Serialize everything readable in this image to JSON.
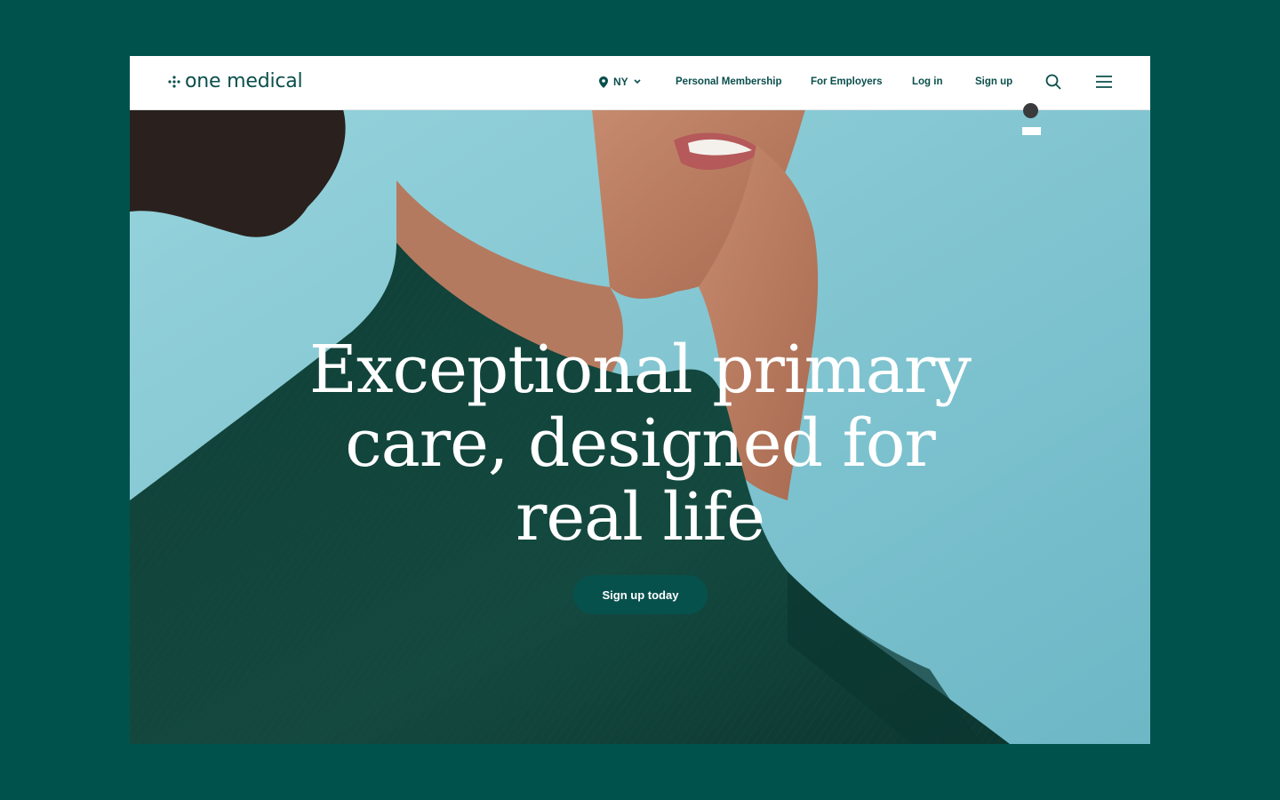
{
  "brand": {
    "name": "one medical",
    "color": "#0a4f4c"
  },
  "nav": {
    "location": {
      "label": "NY",
      "icon": "map-pin-icon",
      "caret": "chevron-down-icon"
    },
    "links": [
      "Personal Membership",
      "For Employers",
      "Log in",
      "Sign up"
    ],
    "search_icon": "search-icon",
    "menu_icon": "hamburger-menu-icon"
  },
  "hero": {
    "headline_lines": [
      "Exceptional primary",
      "care, designed for",
      "real life"
    ],
    "cta_label": "Sign up today",
    "background_color": "#8cc9d4",
    "garment_color": "#0f3e35"
  },
  "page": {
    "background": "#00524d"
  }
}
